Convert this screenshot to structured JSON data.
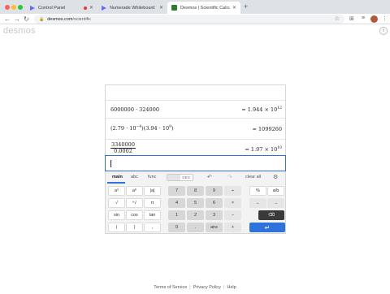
{
  "browser": {
    "tabs": [
      {
        "title": "Control Panel",
        "icon": "play-triangle-icon",
        "recording": true
      },
      {
        "title": "Numerade Whiteboard",
        "icon": "play-triangle-icon"
      },
      {
        "title": "Desmos | Scientific Calculator",
        "icon": "desmos-favicon",
        "active": true
      }
    ],
    "new_tab": "+",
    "url_host": "desmos.com",
    "url_path": "/scientific",
    "colors": {
      "tab_bar": "#dee1e6",
      "accent": "#2f72dc"
    }
  },
  "page": {
    "logo": "desmos",
    "rows": [
      {
        "expr": "6000000 · 324000",
        "result_mantissa": "= 1.944 × 10",
        "result_exp": "12"
      },
      {
        "expr_a": "(2.79 · 10",
        "expr_a_exp": "−4",
        "expr_b": ")(3.94 · 10",
        "expr_b_exp": "9",
        "expr_close": ")",
        "result": "= 1099260"
      },
      {
        "num": "3340000",
        "den": "0.0002",
        "result_mantissa": "= 1.97 × 10",
        "result_exp": "10"
      }
    ],
    "input_value": ""
  },
  "keypad": {
    "tabs": [
      "main",
      "abc",
      "func"
    ],
    "active_tab": "main",
    "angle_modes": [
      "",
      "DEG"
    ],
    "clear_all": "clear all",
    "left_keys": [
      [
        "a²",
        "aᵇ",
        "|a|"
      ],
      [
        "√",
        "ⁿ√",
        "π"
      ],
      [
        "sin",
        "cos",
        "tan"
      ],
      [
        "(",
        ")",
        ","
      ]
    ],
    "num_keys": [
      [
        "7",
        "8",
        "9",
        "÷"
      ],
      [
        "4",
        "5",
        "6",
        "×"
      ],
      [
        "1",
        "2",
        "3",
        "−"
      ],
      [
        "0",
        ".",
        "ans",
        "+"
      ]
    ],
    "right_keys": [
      [
        "%",
        "a/b"
      ],
      [
        "←",
        "→"
      ],
      [
        "⌫"
      ],
      [
        "↵"
      ]
    ]
  },
  "footer": {
    "links": [
      "Terms of Service",
      "Privacy Policy",
      "Help"
    ]
  }
}
